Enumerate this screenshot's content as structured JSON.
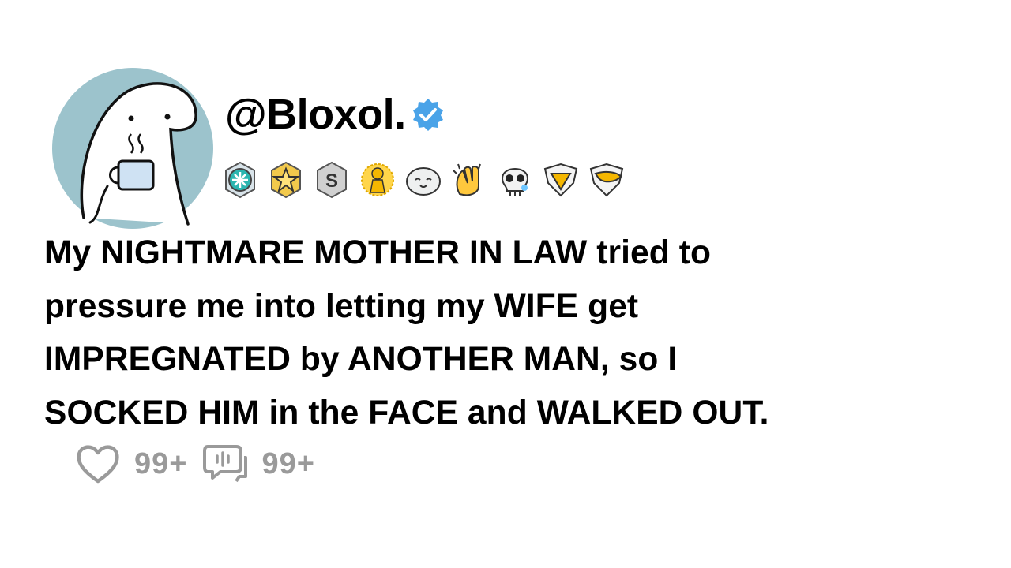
{
  "post": {
    "username": "@Bloxol.",
    "verified": true,
    "title_lines": [
      "My NIGHTMARE MOTHER IN LAW tried to",
      "pressure me into letting my WIFE get",
      "IMPREGNATED by ANOTHER MAN, so I",
      "SOCKED HIM in the FACE and WALKED OUT."
    ],
    "likes": "99+",
    "comments": "99+"
  },
  "awards": [
    "helpful-award-icon",
    "star-award-icon",
    "silver-award-icon",
    "gold-award-icon",
    "seal-award-icon",
    "clap-award-icon",
    "skull-award-icon",
    "gold-shield-award-icon",
    "tongue-award-icon"
  ],
  "colors": {
    "verified": "#4aa3e8",
    "avatar_bg": "#9cc3cc",
    "counts": "#9a9a9a",
    "text": "#000000"
  }
}
